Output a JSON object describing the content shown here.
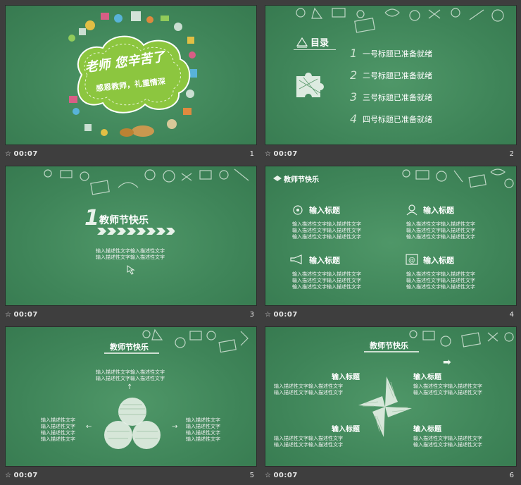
{
  "slides": [
    {
      "number": "1",
      "time": "00:07",
      "headline": "老师 您辛苦了",
      "subline": "感恩教师，礼重情深",
      "colors": {
        "cloud": "#8cc63f",
        "cloud_inner": "#9fd44a"
      }
    },
    {
      "number": "2",
      "time": "00:07",
      "toc_title": "目录",
      "items": [
        {
          "num": "1",
          "label": "一号标题已准备就绪"
        },
        {
          "num": "2",
          "label": "二号标题已准备就绪"
        },
        {
          "num": "3",
          "label": "三号标题已准备就绪"
        },
        {
          "num": "4",
          "label": "四号标题已准备就绪"
        }
      ]
    },
    {
      "number": "3",
      "time": "00:07",
      "big_num": "1",
      "title": "教师节快乐",
      "desc": [
        "输入描述性文字输入描述性文字",
        "输入描述性文字输入描述性文字"
      ]
    },
    {
      "number": "4",
      "time": "00:07",
      "header": "教师节快乐",
      "blocks": [
        {
          "title": "输入标题",
          "lines": [
            "输入描述性文字输入描述性文字",
            "输入描述性文字输入描述性文字",
            "输入描述性文字输入描述性文字"
          ]
        },
        {
          "title": "输入标题",
          "lines": [
            "输入描述性文字输入描述性文字",
            "输入描述性文字输入描述性文字",
            "输入描述性文字输入描述性文字"
          ]
        },
        {
          "title": "输入标题",
          "lines": [
            "输入描述性文字输入描述性文字",
            "输入描述性文字输入描述性文字",
            "输入描述性文字输入描述性文字"
          ]
        },
        {
          "title": "输入标题",
          "lines": [
            "输入描述性文字输入描述性文字",
            "输入描述性文字输入描述性文字",
            "输入描述性文字输入描述性文字"
          ]
        }
      ]
    },
    {
      "number": "5",
      "time": "00:07",
      "title": "教师节快乐",
      "top_text": [
        "输入描述性文字输入描述性文字",
        "输入描述性文字输入描述性文字"
      ],
      "left_text": [
        "输入描述性文字",
        "输入描述性文字",
        "输入描述性文字",
        "输入描述性文字"
      ],
      "right_text": [
        "输入描述性文字",
        "输入描述性文字",
        "输入描述性文字",
        "输入描述性文字"
      ]
    },
    {
      "number": "6",
      "time": "00:07",
      "title": "教师节快乐",
      "quads": [
        {
          "title": "输入标题",
          "lines": [
            "输入描述性文字输入描述性文字",
            "输入描述性文字输入描述性文字"
          ]
        },
        {
          "title": "输入标题",
          "lines": [
            "输入描述性文字输入描述性文字",
            "输入描述性文字输入描述性文字"
          ]
        },
        {
          "title": "输入标题",
          "lines": [
            "输入描述性文字输入描述性文字",
            "输入描述性文字输入描述性文字"
          ]
        },
        {
          "title": "输入标题",
          "lines": [
            "输入描述性文字输入描述性文字",
            "输入描述性文字输入描述性文字"
          ]
        }
      ]
    }
  ]
}
